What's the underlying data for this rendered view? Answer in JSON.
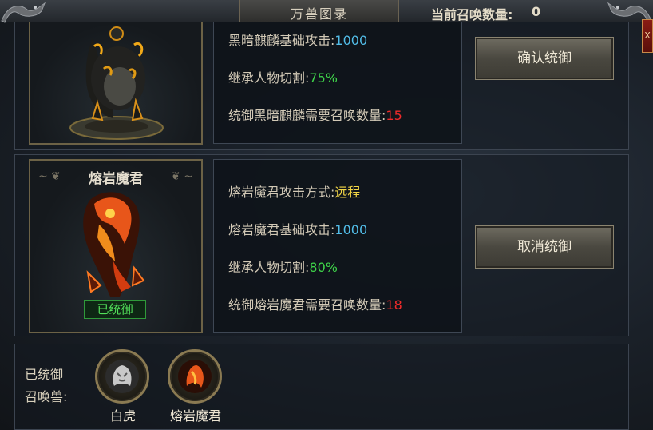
{
  "window": {
    "title": "万兽图录",
    "summon_count_label": "当前召唤数量:",
    "summon_count_value": "0",
    "close_label": "X"
  },
  "beasts": [
    {
      "name": "",
      "attack_line_label": "黑暗麒麟基础攻击:",
      "attack_value": "1000",
      "inherit_label": "继承人物切割:",
      "inherit_value": "75%",
      "command_label": "统御黑暗麒麟需要召唤数量:",
      "command_value": "15",
      "action_label": "确认统御"
    },
    {
      "name": "熔岩魔君",
      "mode_label": "熔岩魔君攻击方式:",
      "mode_value": "远程",
      "attack_line_label": "熔岩魔君基础攻击:",
      "attack_value": "1000",
      "inherit_label": "继承人物切割:",
      "inherit_value": "80%",
      "command_label": "统御熔岩魔君需要召唤数量:",
      "command_value": "18",
      "status_badge": "已统御",
      "action_label": "取消统御"
    }
  ],
  "footer": {
    "label_line1": "已统御",
    "label_line2": "召唤兽:",
    "slots": [
      {
        "name": "白虎",
        "icon": "white-tiger-icon"
      },
      {
        "name": "熔岩魔君",
        "icon": "lava-demon-icon"
      }
    ]
  },
  "colors": {
    "value_blue": "#52bde8",
    "value_green": "#3fd44a",
    "value_red": "#ef2a2a",
    "value_yellow": "#f3d646",
    "badge_green": "#52e05a"
  }
}
